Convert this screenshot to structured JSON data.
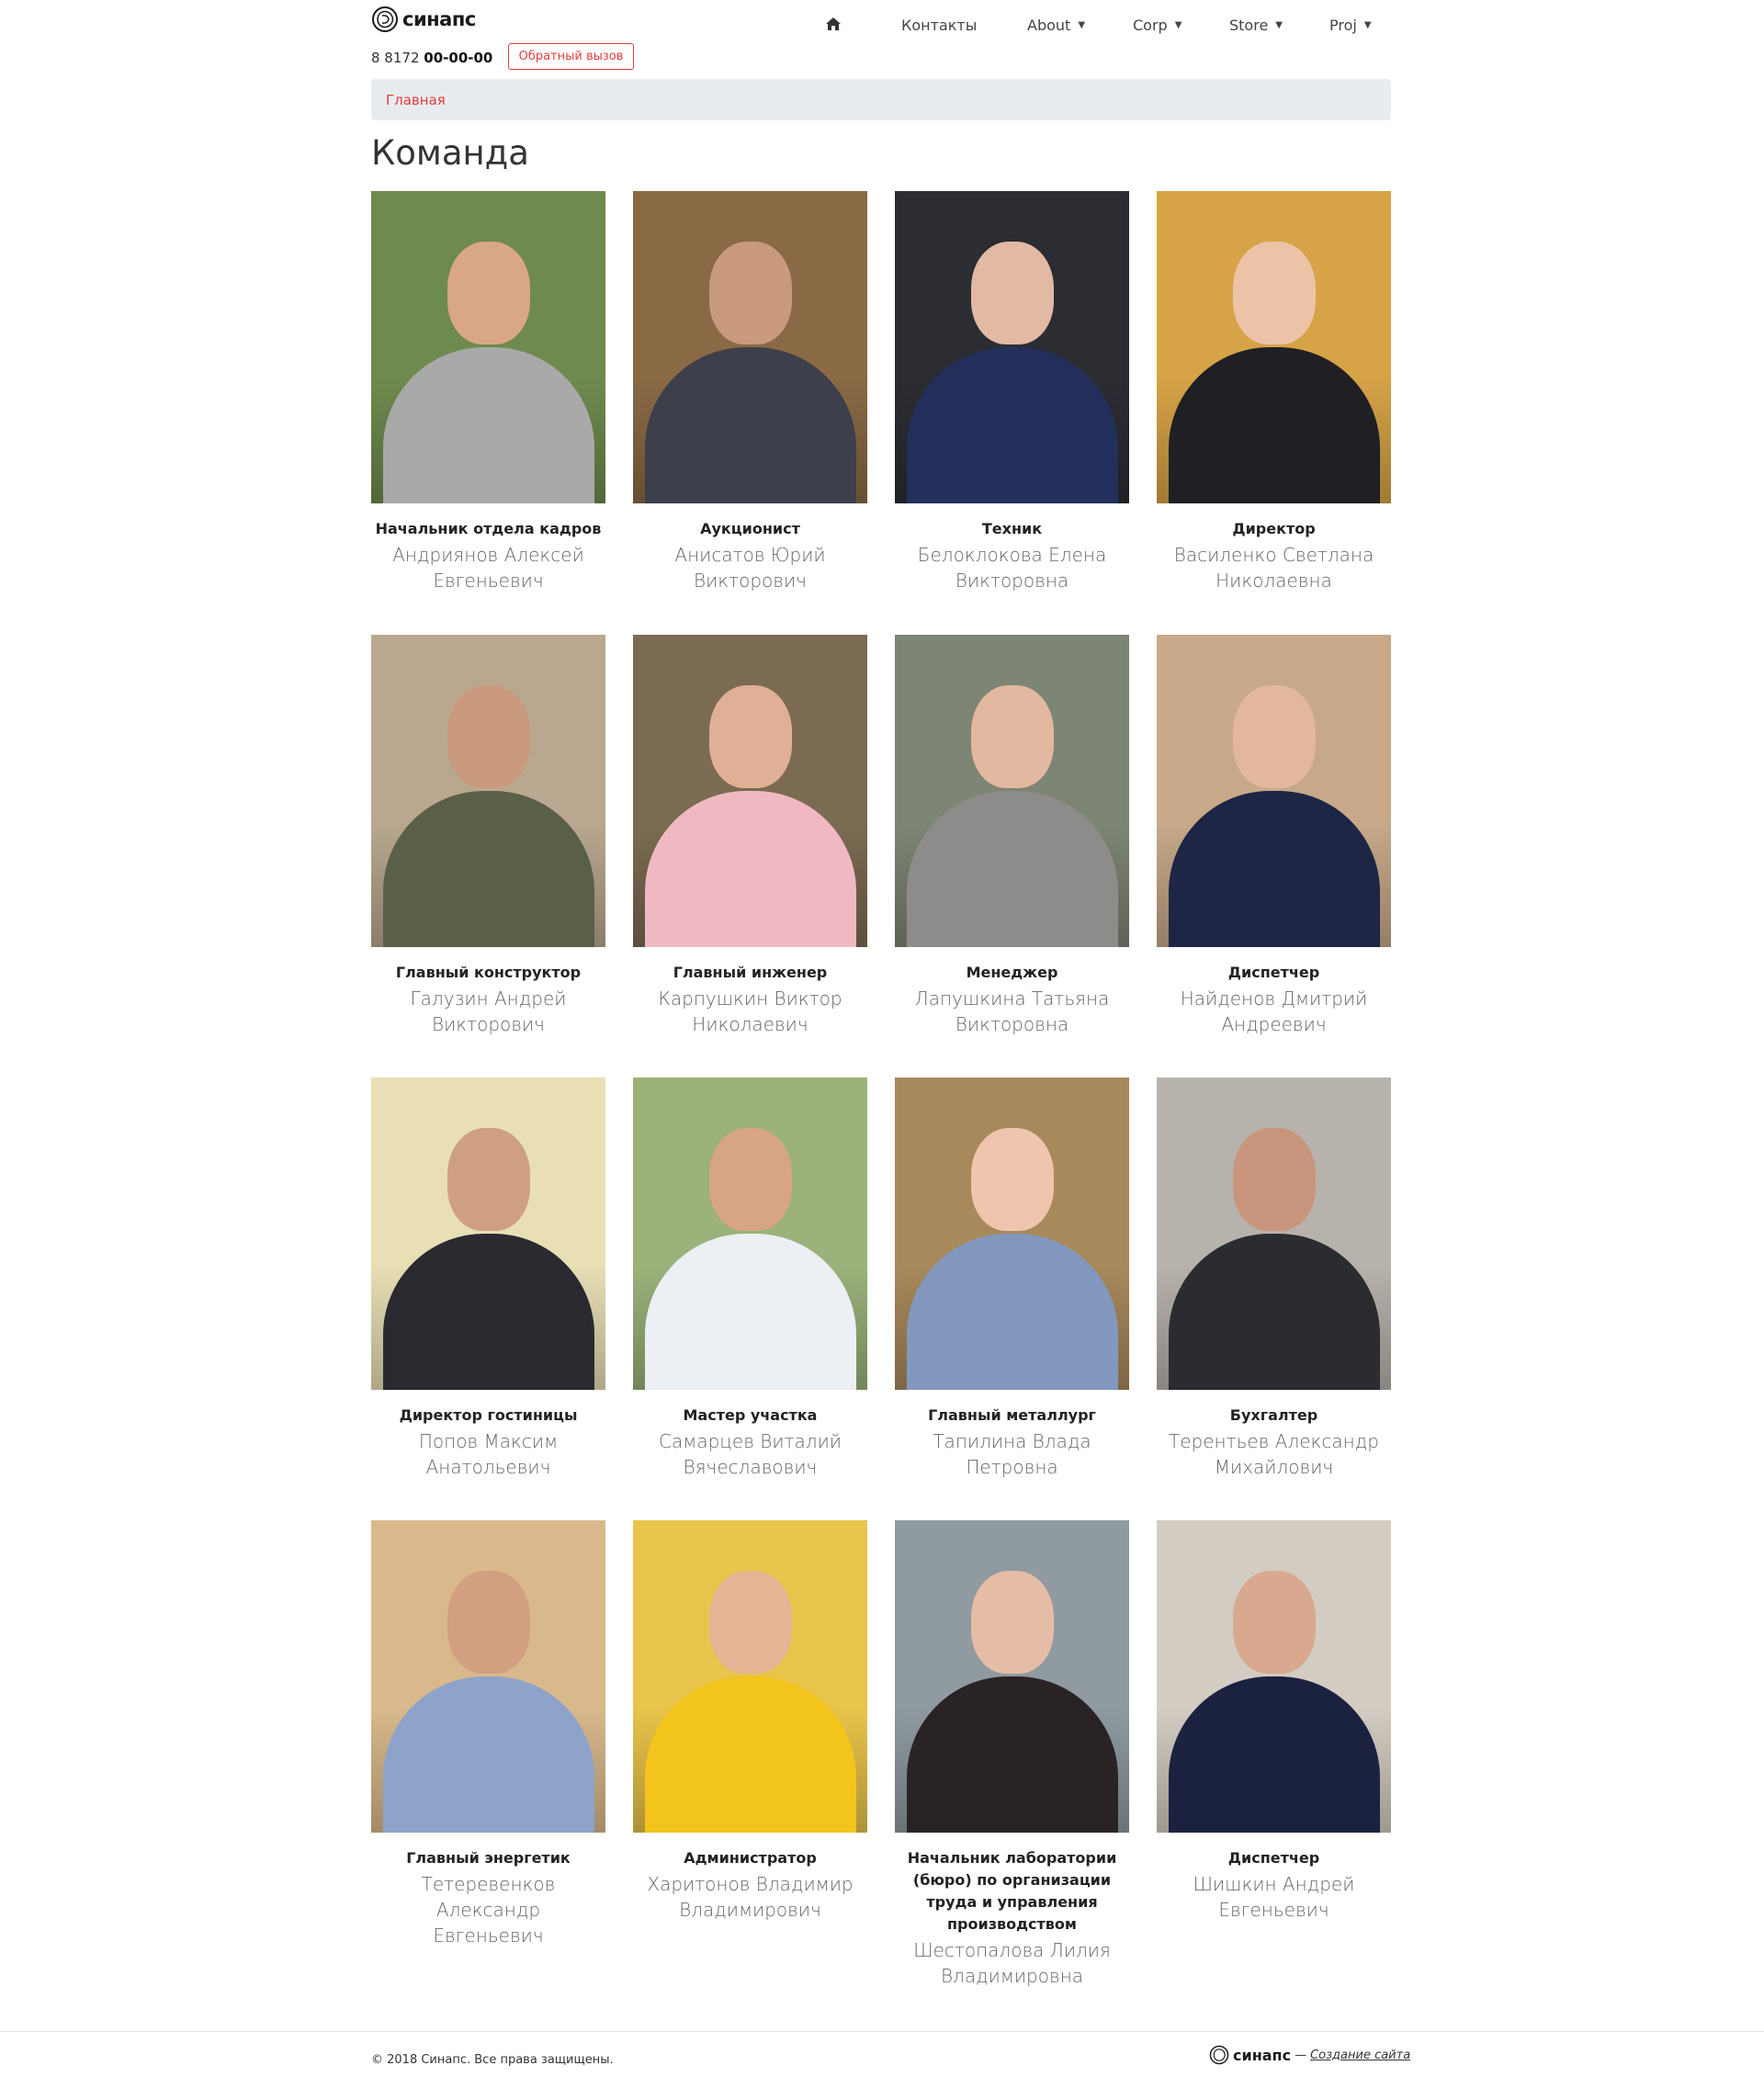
{
  "header": {
    "logo_text": "синапс",
    "phone_prefix": "8 8172",
    "phone_number": "00-00-00",
    "callback_label": "Обратный вызов",
    "nav": [
      {
        "label": "Контакты",
        "dropdown": false
      },
      {
        "label": "About",
        "dropdown": true
      },
      {
        "label": "Corp",
        "dropdown": true
      },
      {
        "label": "Store",
        "dropdown": true
      },
      {
        "label": "Proj",
        "dropdown": true
      }
    ]
  },
  "breadcrumb": {
    "home": "Главная"
  },
  "page_title": "Команда",
  "team": [
    {
      "role": "Начальник отдела кадров",
      "name_line1": "Андриянов Алексей",
      "name_line2": "Евгеньевич",
      "bg": "#6f8a4e",
      "skin": "#d9a688",
      "cloth": "#a9a9a9"
    },
    {
      "role": "Аукционист",
      "name_line1": "Анисатов Юрий",
      "name_line2": "Викторович",
      "bg": "#8a6a45",
      "skin": "#c99a7e",
      "cloth": "#3d3f4a"
    },
    {
      "role": "Техник",
      "name_line1": "Белоклокова Елена",
      "name_line2": "Викторовна",
      "bg": "#2b2d33",
      "skin": "#e2b9a3",
      "cloth": "#23305c"
    },
    {
      "role": "Директор",
      "name_line1": "Василенко Светлана",
      "name_line2": "Николаевна",
      "bg": "#d6a347",
      "skin": "#edc3a8",
      "cloth": "#1f1f24"
    },
    {
      "role": "Главный конструктор",
      "name_line1": "Галузин Андрей",
      "name_line2": "Викторович",
      "bg": "#b9a88f",
      "skin": "#c99a7e",
      "cloth": "#5a5f48"
    },
    {
      "role": "Главный инженер",
      "name_line1": "Карпушкин Виктор",
      "name_line2": "Николаевич",
      "bg": "#7b6b52",
      "skin": "#e0b096",
      "cloth": "#f0b9c2"
    },
    {
      "role": "Менеджер",
      "name_line1": "Лапушкина Татьяна",
      "name_line2": "Викторовна",
      "bg": "#7d8574",
      "skin": "#e3b8a0",
      "cloth": "#8e8c8b"
    },
    {
      "role": "Диспетчер",
      "name_line1": "Найденов Дмитрий",
      "name_line2": "Андреевич",
      "bg": "#c7a98a",
      "skin": "#e3b79b",
      "cloth": "#1d2644"
    },
    {
      "role": "Директор гостиницы",
      "name_line1": "Попов Максим",
      "name_line2": "Анатольевич",
      "bg": "#e8dfb5",
      "skin": "#cf9f83",
      "cloth": "#2a2a30"
    },
    {
      "role": "Мастер участка",
      "name_line1": "Самарцев Виталий",
      "name_line2": "Вячеславович",
      "bg": "#9bb27a",
      "skin": "#d7a486",
      "cloth": "#eceff3"
    },
    {
      "role": "Главный металлург",
      "name_line1": "Тапилина Влада",
      "name_line2": "Петровна",
      "bg": "#a8895c",
      "skin": "#efc6ad",
      "cloth": "#8298be"
    },
    {
      "role": "Бухгалтер",
      "name_line1": "Терентьев Александр",
      "name_line2": "Михайлович",
      "bg": "#b7b2ac",
      "skin": "#c9957c",
      "cloth": "#2b2c30"
    },
    {
      "role": "Главный энергетик",
      "name_line1": "Тетеревенков Александр",
      "name_line2": "Евгеньевич",
      "bg": "#d9b98c",
      "skin": "#d29f80",
      "cloth": "#8ea3c9"
    },
    {
      "role": "Администратор",
      "name_line1": "Харитонов Владимир",
      "name_line2": "Владимирович",
      "bg": "#e8c44a",
      "skin": "#e6b394",
      "cloth": "#f3c41b"
    },
    {
      "role": "Начальник лаборатории (бюро) по организации труда и управления производством",
      "name_line1": "Шестопалова Лилия",
      "name_line2": "Владимировна",
      "bg": "#8f9aa1",
      "skin": "#e5bda6",
      "cloth": "#2a2326"
    },
    {
      "role": "Диспетчер",
      "name_line1": "Шишкин Андрей",
      "name_line2": "Евгеньевич",
      "bg": "#d3ccc2",
      "skin": "#d8a98e",
      "cloth": "#1b2240"
    }
  ],
  "footer": {
    "copyright": "© 2018 Синапс. Все права защищены.",
    "logo_text": "синапс",
    "dash": "—",
    "credit": "Создание сайта"
  },
  "colors": {
    "accent": "#e23d3d",
    "breadcrumb_bg": "#e9ecef"
  }
}
